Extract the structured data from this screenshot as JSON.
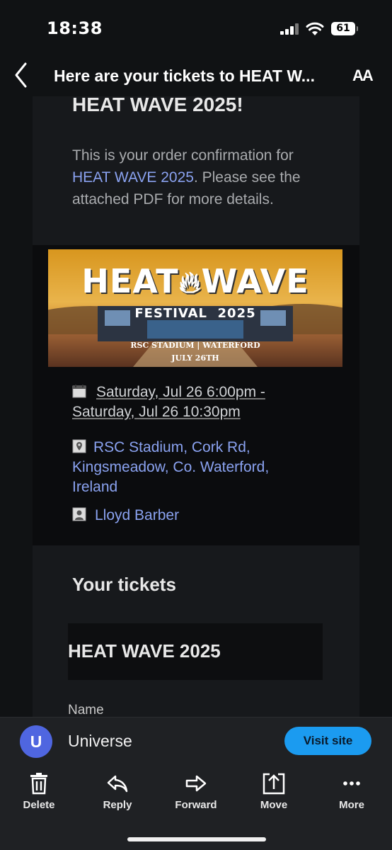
{
  "status": {
    "time": "18:38",
    "battery": "61"
  },
  "nav": {
    "subject": "Here are your tickets to HEAT W...",
    "text_size_label": "AA"
  },
  "email": {
    "heading": "HEAT WAVE 2025!",
    "intro_before": "This is your order confirmation for ",
    "intro_link": "HEAT WAVE 2025",
    "intro_after": ". Please see the attached PDF for more details.",
    "banner": {
      "title_left": "HEAT",
      "title_right": "WAVE",
      "subtitle": "FESTIVAL  2025",
      "venue": "RSC STADIUM | WATERFORD",
      "date": "JULY 26TH"
    },
    "date_text": "Saturday, Jul 26 6:00pm - Saturday, Jul 26 10:30pm",
    "location": "RSC Stadium, Cork Rd, Kingsmeadow, Co. Waterford, Ireland",
    "organizer": "Lloyd Barber",
    "tickets_title": "Your tickets",
    "ticket_event": "HEAT WAVE 2025",
    "name_label": "Name"
  },
  "sender": {
    "avatar_letter": "U",
    "name": "Universe",
    "visit_label": "Visit site"
  },
  "toolbar": {
    "delete": "Delete",
    "reply": "Reply",
    "forward": "Forward",
    "move": "Move",
    "more": "More"
  },
  "colors": {
    "link": "#8aa2f0",
    "accent_button": "#1b9bf0",
    "avatar": "#4f66e0",
    "background": "#101214"
  },
  "icons": [
    "back-chevron-icon",
    "calendar-icon",
    "location-pin-icon",
    "person-icon",
    "trash-icon",
    "reply-icon",
    "forward-icon",
    "move-icon",
    "more-dots-icon",
    "signal-icon",
    "wifi-icon",
    "battery-icon"
  ]
}
